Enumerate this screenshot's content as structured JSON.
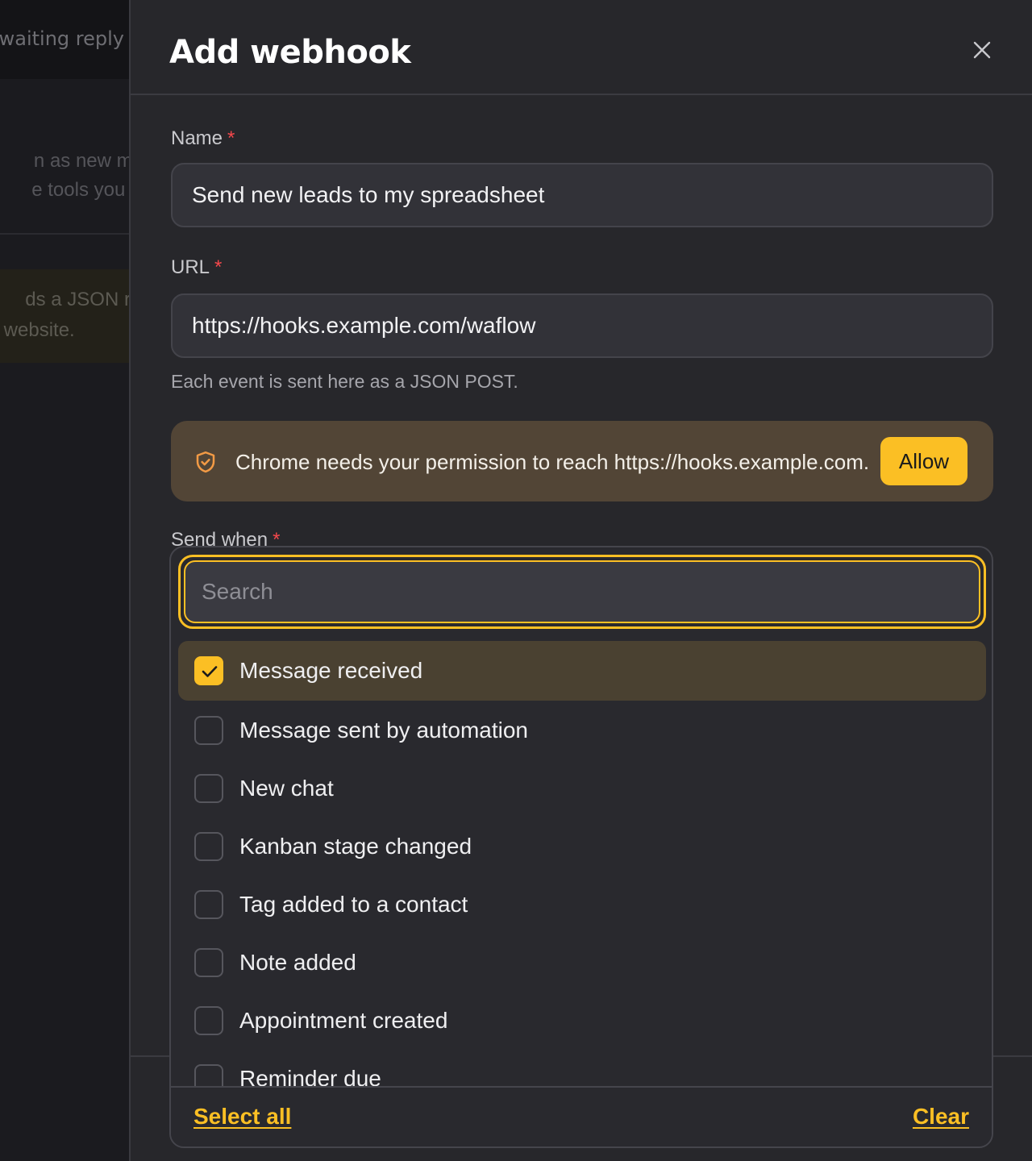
{
  "background": {
    "title": "waiting reply",
    "text_line_1": "n as new mess",
    "text_line_2": "e tools you alre",
    "note_line_1": "ds a JSON requ",
    "note_line_2": "r website."
  },
  "modal": {
    "title": "Add webhook",
    "close_icon": "close-icon",
    "name": {
      "label": "Name",
      "required_mark": "*",
      "value": "Send new leads to my spreadsheet"
    },
    "url": {
      "label": "URL",
      "required_mark": "*",
      "value": "https://hooks.example.com/waflow",
      "hint": "Each event is sent here as a JSON POST."
    },
    "permission": {
      "icon": "shield-check-icon",
      "text": "Chrome needs your permission to reach https://hooks.example.com.",
      "button_label": "Allow"
    },
    "send_when": {
      "label": "Send when",
      "required_mark": "*"
    }
  },
  "dropdown": {
    "search_placeholder": "Search",
    "search_value": "",
    "options": [
      {
        "label": "Message received",
        "checked": true
      },
      {
        "label": "Message sent by automation",
        "checked": false
      },
      {
        "label": "New chat",
        "checked": false
      },
      {
        "label": "Kanban stage changed",
        "checked": false
      },
      {
        "label": "Tag added to a contact",
        "checked": false
      },
      {
        "label": "Note added",
        "checked": false
      },
      {
        "label": "Appointment created",
        "checked": false
      },
      {
        "label": "Reminder due",
        "checked": false
      }
    ],
    "select_all_label": "Select all",
    "clear_label": "Clear"
  },
  "colors": {
    "accent": "#fbbf24",
    "panel": "#27272b",
    "permission_bg": "#524536",
    "selected_option_bg": "#4a4131",
    "required": "#f5484c"
  }
}
